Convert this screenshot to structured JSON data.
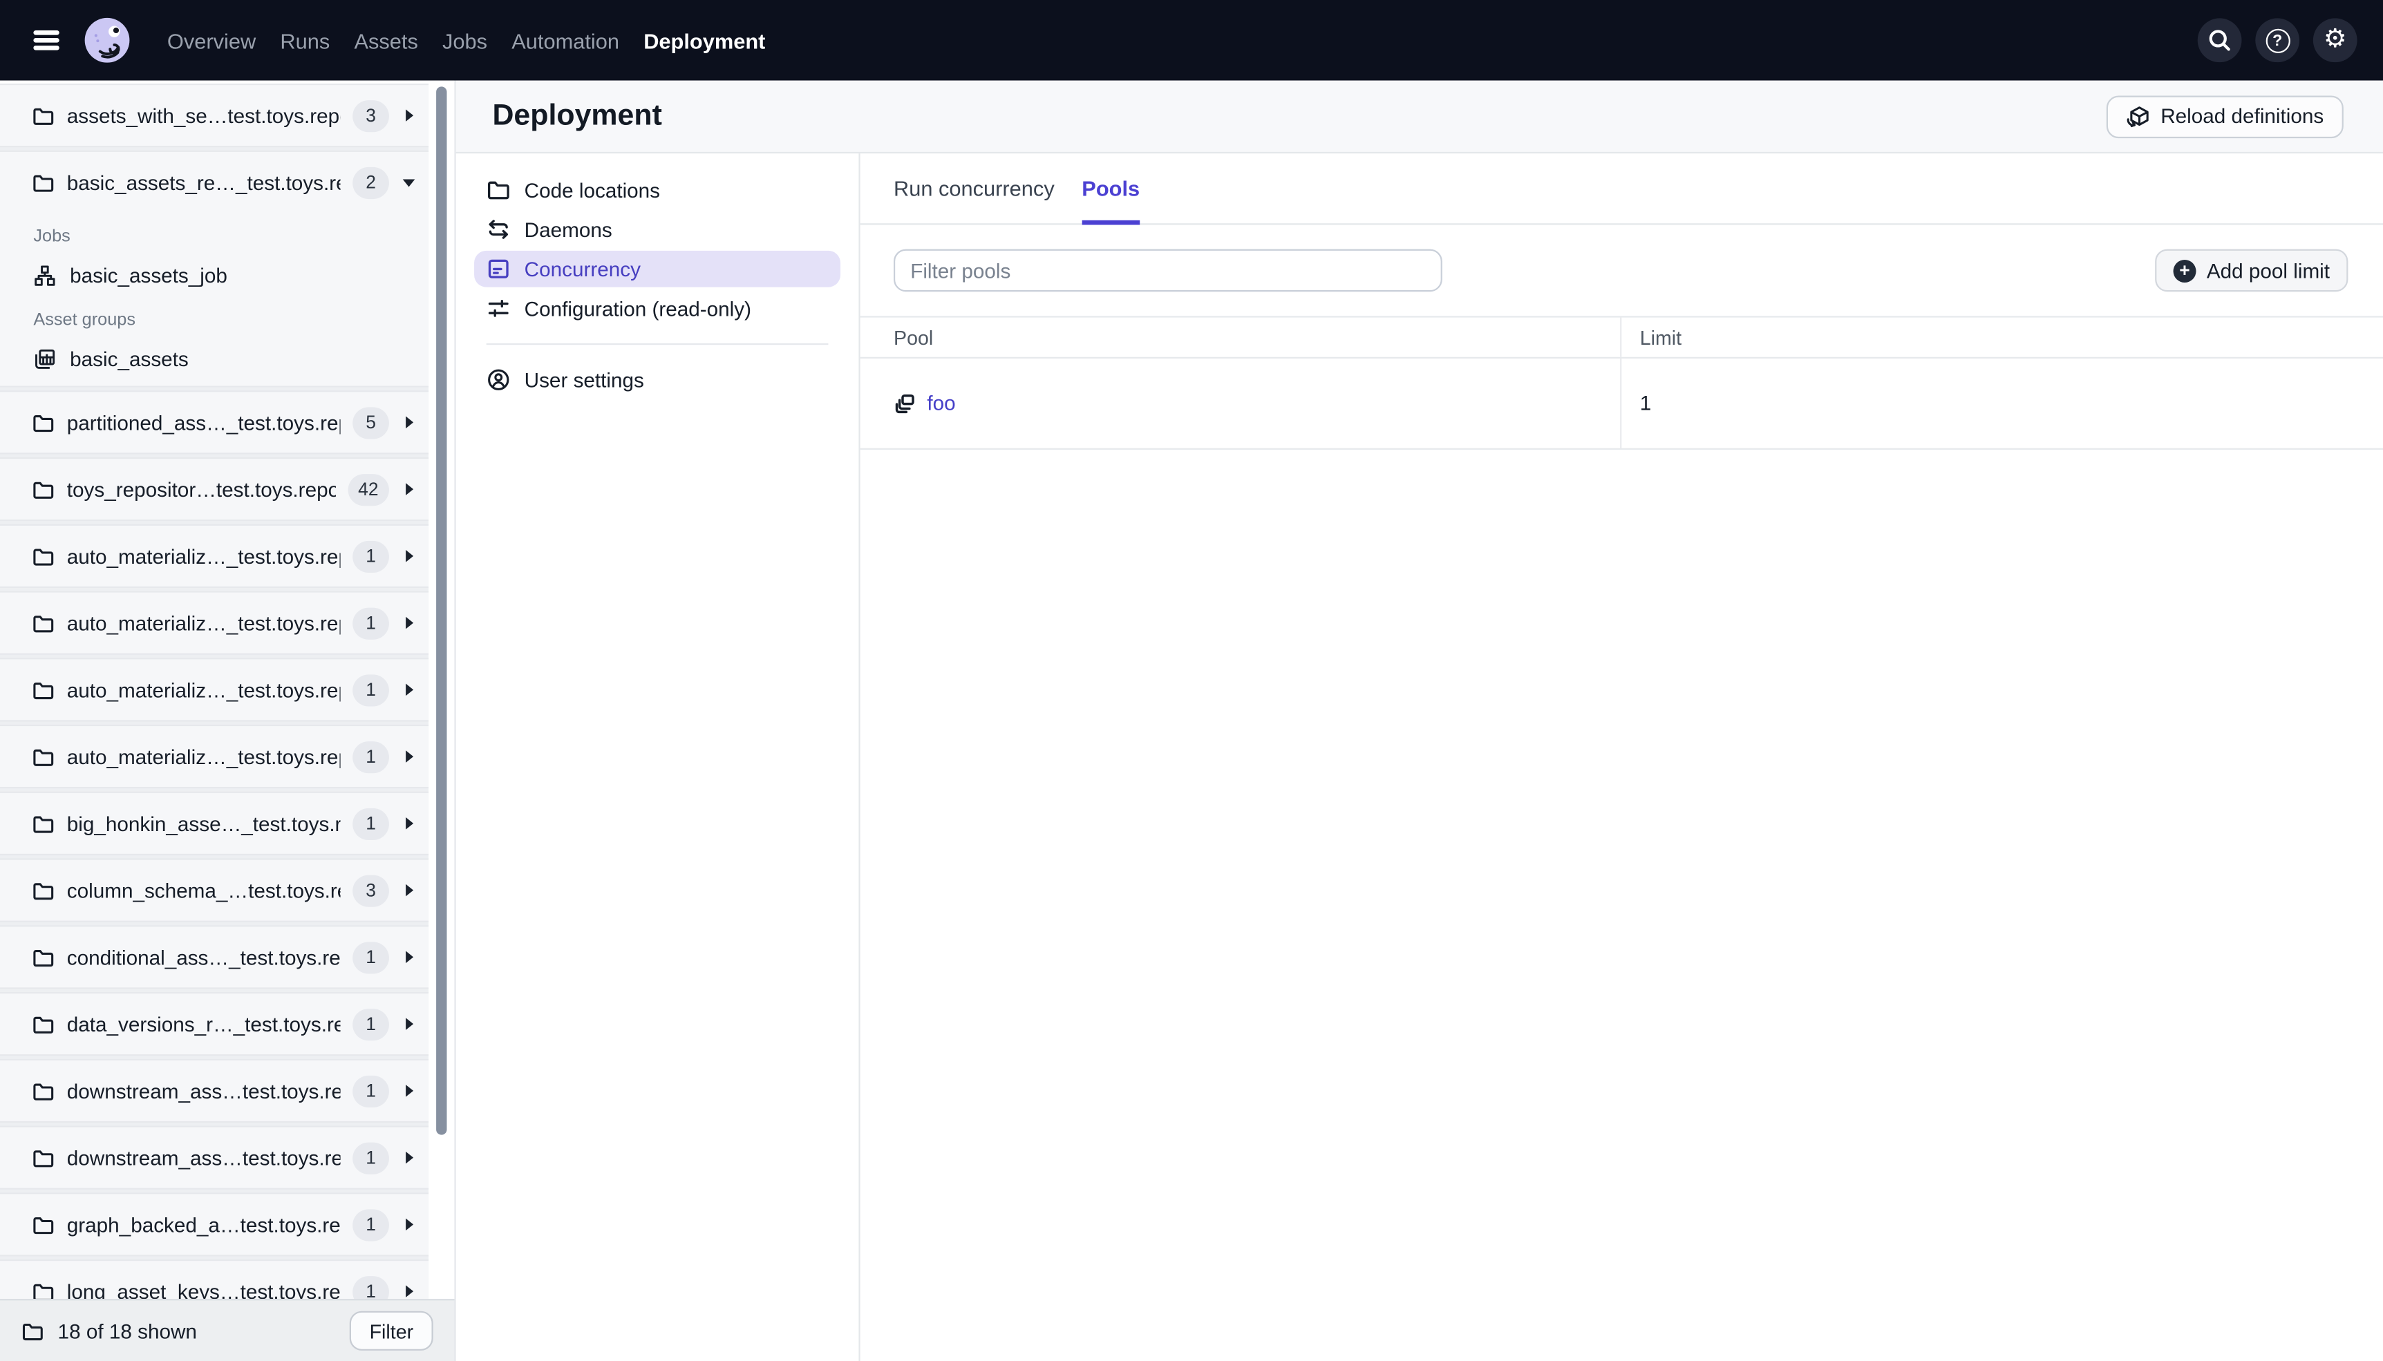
{
  "topnav": {
    "items": [
      {
        "label": "Overview"
      },
      {
        "label": "Runs"
      },
      {
        "label": "Assets"
      },
      {
        "label": "Jobs"
      },
      {
        "label": "Automation"
      },
      {
        "label": "Deployment"
      }
    ]
  },
  "icons": {
    "plus_glyph": "+",
    "question_glyph": "?",
    "gear_glyph": "⚙"
  },
  "sidebar": {
    "rows": [
      {
        "name": "assets_with_se…test.toys.repo",
        "count": "3"
      },
      {
        "name": "basic_assets_re…_test.toys.rep",
        "count": "2"
      },
      {
        "name": "partitioned_ass…_test.toys.rep",
        "count": "5"
      },
      {
        "name": "toys_repositor…test.toys.repo",
        "count": "42"
      },
      {
        "name": "auto_materializ…_test.toys.repo",
        "count": "1"
      },
      {
        "name": "auto_materializ…_test.toys.repo",
        "count": "1"
      },
      {
        "name": "auto_materializ…_test.toys.repo",
        "count": "1"
      },
      {
        "name": "auto_materializ…_test.toys.repo",
        "count": "1"
      },
      {
        "name": "big_honkin_asse…_test.toys.rep",
        "count": "1"
      },
      {
        "name": "column_schema_…test.toys.rep",
        "count": "3"
      },
      {
        "name": "conditional_ass…_test.toys.repo",
        "count": "1"
      },
      {
        "name": "data_versions_r…_test.toys.rep",
        "count": "1"
      },
      {
        "name": "downstream_ass…test.toys.rep",
        "count": "1"
      },
      {
        "name": "downstream_ass…test.toys.rep",
        "count": "1"
      },
      {
        "name": "graph_backed_a…test.toys.repo",
        "count": "1"
      },
      {
        "name": "long_asset_keys…test.toys.rep",
        "count": "1"
      }
    ],
    "expanded": {
      "jobs_header": "Jobs",
      "job_name": "basic_assets_job",
      "asset_groups_header": "Asset groups",
      "asset_group_name": "basic_assets"
    },
    "footer": {
      "count_label": "18 of 18 shown",
      "filter_button": "Filter"
    }
  },
  "deployment": {
    "title": "Deployment",
    "reload_button": "Reload definitions",
    "nav": [
      {
        "label": "Code locations"
      },
      {
        "label": "Daemons"
      },
      {
        "label": "Concurrency"
      },
      {
        "label": "Configuration (read-only)"
      }
    ],
    "user_settings_label": "User settings",
    "tabs": [
      {
        "label": "Run concurrency"
      },
      {
        "label": "Pools"
      }
    ],
    "pools": {
      "filter_placeholder": "Filter pools",
      "add_button": "Add pool limit",
      "table": {
        "columns": [
          "Pool",
          "Limit"
        ],
        "rows": [
          {
            "pool": "foo",
            "limit": "1"
          }
        ]
      }
    }
  },
  "colors": {
    "accent": "#4B40D2",
    "topbar_bg": "#0C101D",
    "active_pill_bg": "#E4E1F8"
  }
}
